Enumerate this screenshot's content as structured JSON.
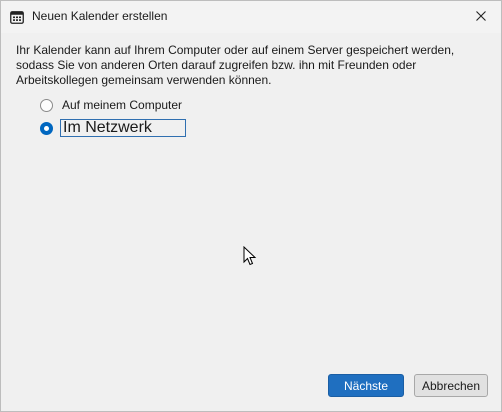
{
  "window": {
    "title": "Neuen Kalender erstellen",
    "icon": "calendar-icon",
    "close_icon": "close-icon"
  },
  "description": "Ihr Kalender kann auf Ihrem Computer oder auf einem Server gespeichert werden, sodass Sie von anderen Orten darauf zugreifen bzw. ihn mit Freunden oder Arbeitskollegen gemeinsam verwenden können.",
  "options": {
    "computer": {
      "label": "Auf meinem Computer",
      "checked": false
    },
    "network": {
      "label": "Im Netzwerk",
      "checked": true
    }
  },
  "buttons": {
    "next": "Nächste",
    "cancel": "Abbrechen"
  },
  "colors": {
    "accent": "#0067c0",
    "primary_button": "#1f6fc0",
    "background": "#f0f0f0"
  }
}
